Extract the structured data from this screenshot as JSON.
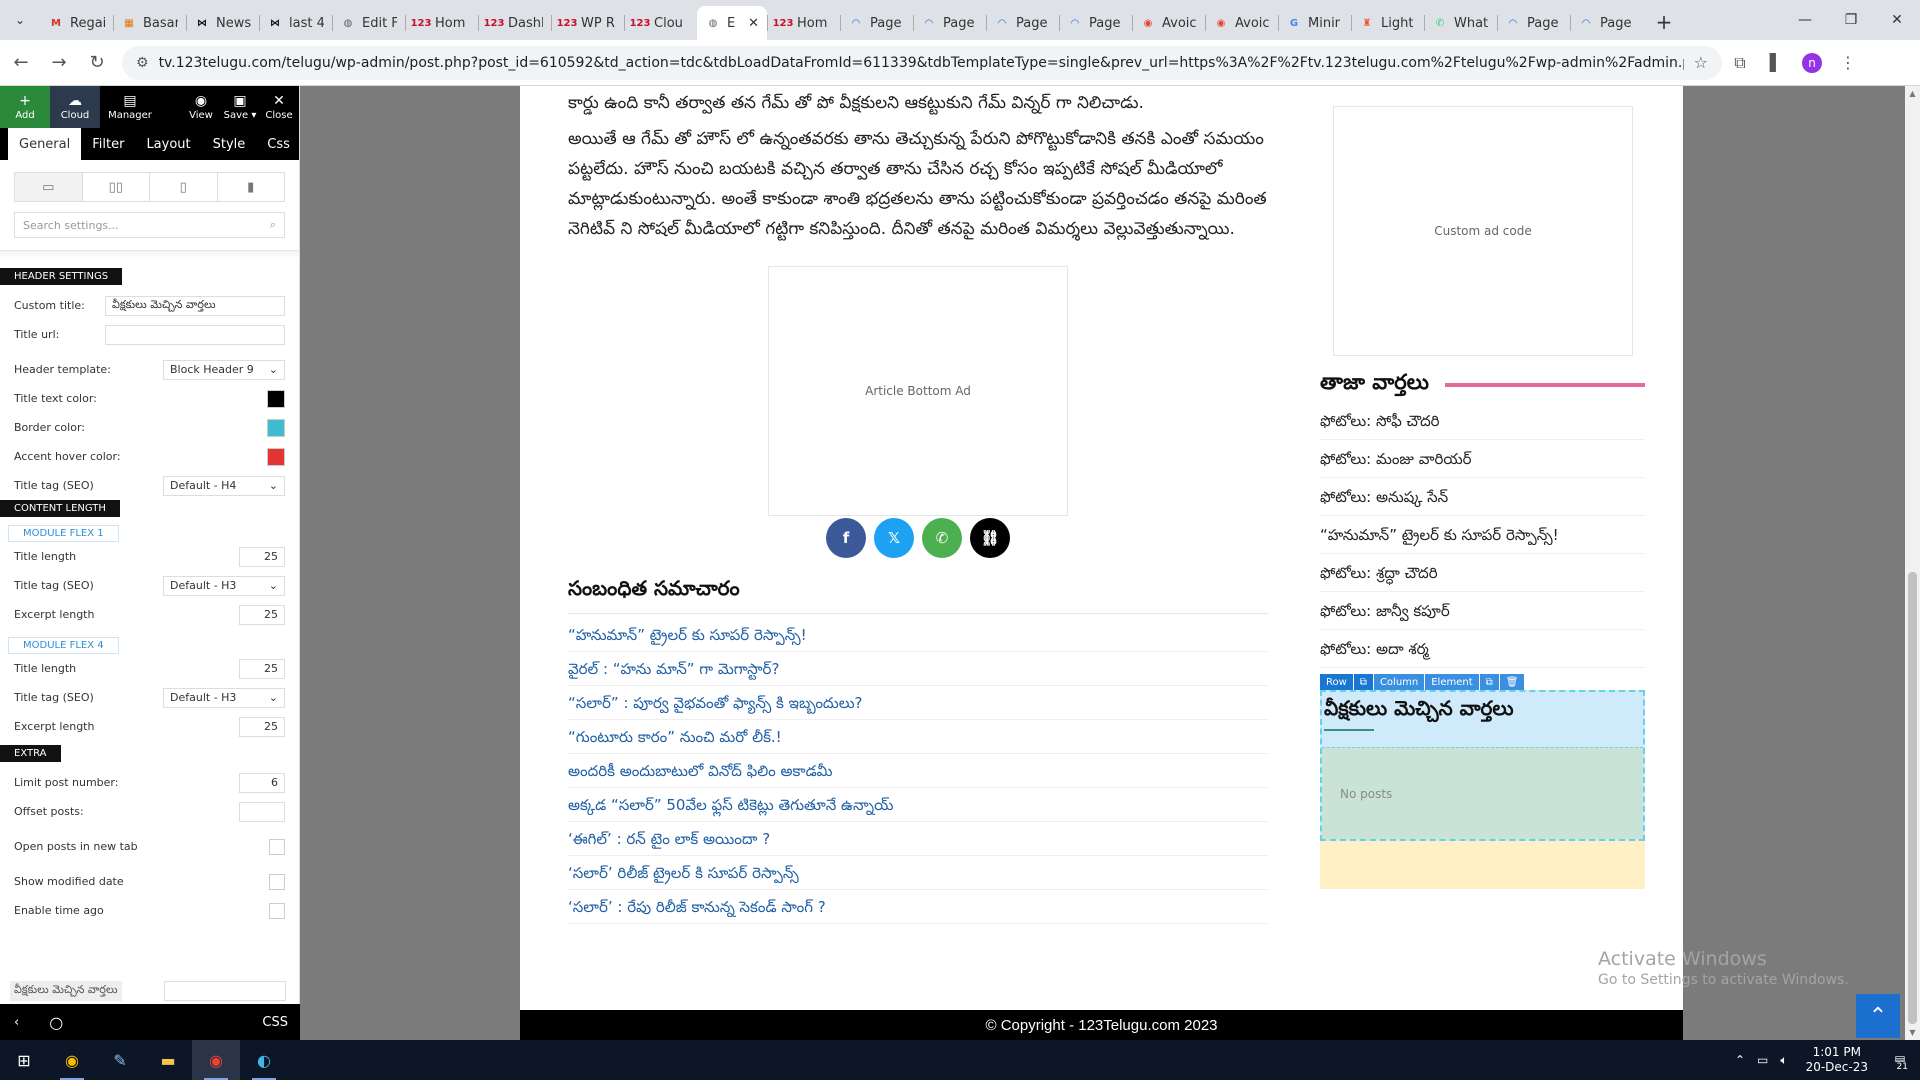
{
  "browser": {
    "tabs": [
      {
        "title": "Regai",
        "icon": "gmail-icon",
        "icon_char": "M",
        "color": "#d93025"
      },
      {
        "title": "Basar",
        "icon": "puzzle-icon",
        "icon_char": "▦",
        "color": "#e37400"
      },
      {
        "title": "News",
        "icon": "bowtie-icon",
        "icon_char": "⋈",
        "color": "#111111"
      },
      {
        "title": "last 4",
        "icon": "bowtie-icon",
        "icon_char": "⋈",
        "color": "#111111"
      },
      {
        "title": "Edit F",
        "icon": "globe-icon",
        "icon_char": "◍",
        "color": "#5f6368"
      },
      {
        "title": "Hom",
        "icon": "site-123-icon",
        "icon_char": "123",
        "color": "#c8102e"
      },
      {
        "title": "Dashl",
        "icon": "site-123-icon",
        "icon_char": "123",
        "color": "#c8102e"
      },
      {
        "title": "WP R",
        "icon": "site-123-icon",
        "icon_char": "123",
        "color": "#c8102e"
      },
      {
        "title": "Clou",
        "icon": "site-123-icon",
        "icon_char": "123",
        "color": "#c8102e"
      },
      {
        "title": "E",
        "icon": "globe-icon",
        "icon_char": "◍",
        "color": "#5f6368",
        "active": true
      },
      {
        "title": "Hom",
        "icon": "site-123-icon",
        "icon_char": "123",
        "color": "#c8102e"
      },
      {
        "title": "Page",
        "icon": "pagespeed-icon",
        "icon_char": "◠",
        "color": "#1a73e8"
      },
      {
        "title": "Page",
        "icon": "pagespeed-icon",
        "icon_char": "◠",
        "color": "#1a73e8"
      },
      {
        "title": "Page",
        "icon": "pagespeed-icon",
        "icon_char": "◠",
        "color": "#1a73e8"
      },
      {
        "title": "Page",
        "icon": "pagespeed-icon",
        "icon_char": "◠",
        "color": "#1a73e8"
      },
      {
        "title": "Avoic",
        "icon": "chrome-icon",
        "icon_char": "◉",
        "color": "#ea4335"
      },
      {
        "title": "Avoic",
        "icon": "chrome-icon",
        "icon_char": "◉",
        "color": "#ea4335"
      },
      {
        "title": "Minir",
        "icon": "google-icon",
        "icon_char": "G",
        "color": "#4285f4"
      },
      {
        "title": "Light",
        "icon": "lighthouse-icon",
        "icon_char": "♜",
        "color": "#f4511e"
      },
      {
        "title": "What",
        "icon": "whatsapp-icon",
        "icon_char": "✆",
        "color": "#25d366"
      },
      {
        "title": "Page",
        "icon": "pagespeed-icon",
        "icon_char": "◠",
        "color": "#1a73e8"
      },
      {
        "title": "Page",
        "icon": "pagespeed-icon",
        "icon_char": "◠",
        "color": "#1a73e8"
      }
    ],
    "url": "tv.123telugu.com/telugu/wp-admin/post.php?post_id=610592&td_action=tdc&tdbLoadDataFromId=611339&tdbTemplateType=single&prev_url=https%3A%2F%2Ftv.123telugu.com%2Ftelugu%2Fwp-admin%2Fadmin.php%3Fpage%3Dtdb_cloud_te..."
  },
  "panel": {
    "top_buttons": {
      "add": "Add",
      "cloud": "Cloud",
      "manager": "Manager",
      "view": "View",
      "save": "Save ▾",
      "close": "Close"
    },
    "tabs": [
      "General",
      "Filter",
      "Layout",
      "Style",
      "Css"
    ],
    "search_placeholder": "Search settings...",
    "sections": {
      "header": "HEADER SETTINGS",
      "content": "CONTENT LENGTH",
      "flex1": "MODULE FLEX 1",
      "flex4": "MODULE FLEX 4",
      "extra": "EXTRA"
    },
    "fields": {
      "custom_title_label": "Custom title:",
      "custom_title_value": "వీక్షకులు మెచ్చిన వార్తలు",
      "title_url_label": "Title url:",
      "header_template_label": "Header template:",
      "header_template_value": "Block Header 9",
      "title_text_color_label": "Title text color:",
      "title_text_color": "#000000",
      "border_color_label": "Border color:",
      "border_color": "#3fbcd0",
      "accent_hover_color_label": "Accent hover color:",
      "accent_hover_color": "#e33434",
      "title_tag_label": "Title tag (SEO)",
      "title_tag_h4": "Default - H4",
      "title_length_label": "Title length",
      "title_length_1": "25",
      "title_tag_h3": "Default - H3",
      "excerpt_length_label": "Excerpt length",
      "excerpt_length_1": "25",
      "title_length_4": "25",
      "excerpt_length_4": "25",
      "limit_label": "Limit post number:",
      "limit_value": "6",
      "offset_label": "Offset posts:",
      "open_new_tab_label": "Open posts in new tab",
      "show_modified_label": "Show modified date",
      "enable_time_ago_label": "Enable time ago"
    },
    "crumb_label": "వీక్షకులు మెచ్చిన వార్తలు",
    "footer_css": "CSS"
  },
  "article": {
    "para1": "కార్డు ఉంది కానీ తర్వాత తన గేమ్ తో పో వీక్షకులని ఆకట్టుకుని గేమ్ విన్నర్ గా నిలిచాడు.",
    "para2": "అయితే ఆ గేమ్ తో హౌస్ లో ఉన్నంతవరకు తాను తెచ్చుకున్న పేరుని పోగొట్టుకోడానికి తనకి ఎంతో సమయం పట్టలేదు. హౌస్ నుంచి బయటకి వచ్చిన తర్వాత తాను చేసిన రచ్చ కోసం ఇప్పటికే సోషల్ మీడియాలో మాట్లాడుకుంటున్నారు. అంతే కాకుండా శాంతి భద్రతలను తాను పట్టించుకోకుండా ప్రవర్తించడం తనపై మరింత నెగిటివ్ ని సోషల్ మీడియాలో గట్టిగా కనిపిస్తుంది. దీనితో తనపై మరింత విమర్శలు వెల్లువెత్తుతున్నాయి.",
    "ad_label": "Article Bottom Ad",
    "related_heading": "సంబంధిత సమాచారం",
    "related": [
      "“హనుమాన్” ట్రైలర్ కు సూపర్ రెస్పాన్స్!",
      "వైరల్ : “హను మాన్” గా మెగాస్టార్?",
      "“సలార్” : పూర్వ వైభవంతో ఫ్యాన్స్ కి ఇబ్బందులు?",
      "“గుంటూరు కారం” నుంచి మరో లీక్.!",
      "అందరికీ అందుబాటులో వినోద్ ఫిలిం అకాడమీ",
      "అక్కడ “సలార్” 50వేల ఫ్లస్ టికెట్లు తెగుతూనే ఉన్నాయ్",
      "‘ఈగిల్’ : రన్ టైం లాక్ అయిందా ?",
      "‘సలార్’ రిలీజ్ ట్రైలర్ కి సూపర్ రెస్పాన్స్",
      "‘సలార్’ : రేపు రిలీజ్ కానున్న సెకండ్ సాంగ్ ?"
    ]
  },
  "sidebar": {
    "ad_label": "Custom ad code",
    "latest_heading": "తాజా వార్తలు",
    "latest": [
      "ఫోటోలు: సోఫీ చౌదరి",
      "ఫోటోలు: మంజు వారియర్",
      "ఫోటోలు: అనుష్క సేన్",
      "“హనుమాన్” ట్రైలర్ కు సూపర్ రెస్పాన్స్!",
      "ఫోటోలు: శ్రద్ధా చౌదరి",
      "ఫోటోలు: జాన్వీ కపూర్",
      "ఫోటోలు: అదా శర్మ"
    ],
    "tools": {
      "row": "Row",
      "column": "Column",
      "element": "Element"
    },
    "block_title": "వీక్షకులు మెచ్చిన వార్తలు",
    "no_posts": "No posts"
  },
  "footer": {
    "copyright": "© Copyright - 123Telugu.com 2023"
  },
  "watermark": {
    "line1": "Activate Windows",
    "line2": "Go to Settings to activate Windows."
  },
  "taskbar": {
    "time": "1:01 PM",
    "date": "20-Dec-23",
    "notifications": "21"
  },
  "colors": {
    "share_facebook": "#3b5998",
    "share_x": "#1da1f2",
    "share_whatsapp": "#4caf50",
    "share_link": "#000000",
    "accent_pink": "#e46a9e"
  }
}
